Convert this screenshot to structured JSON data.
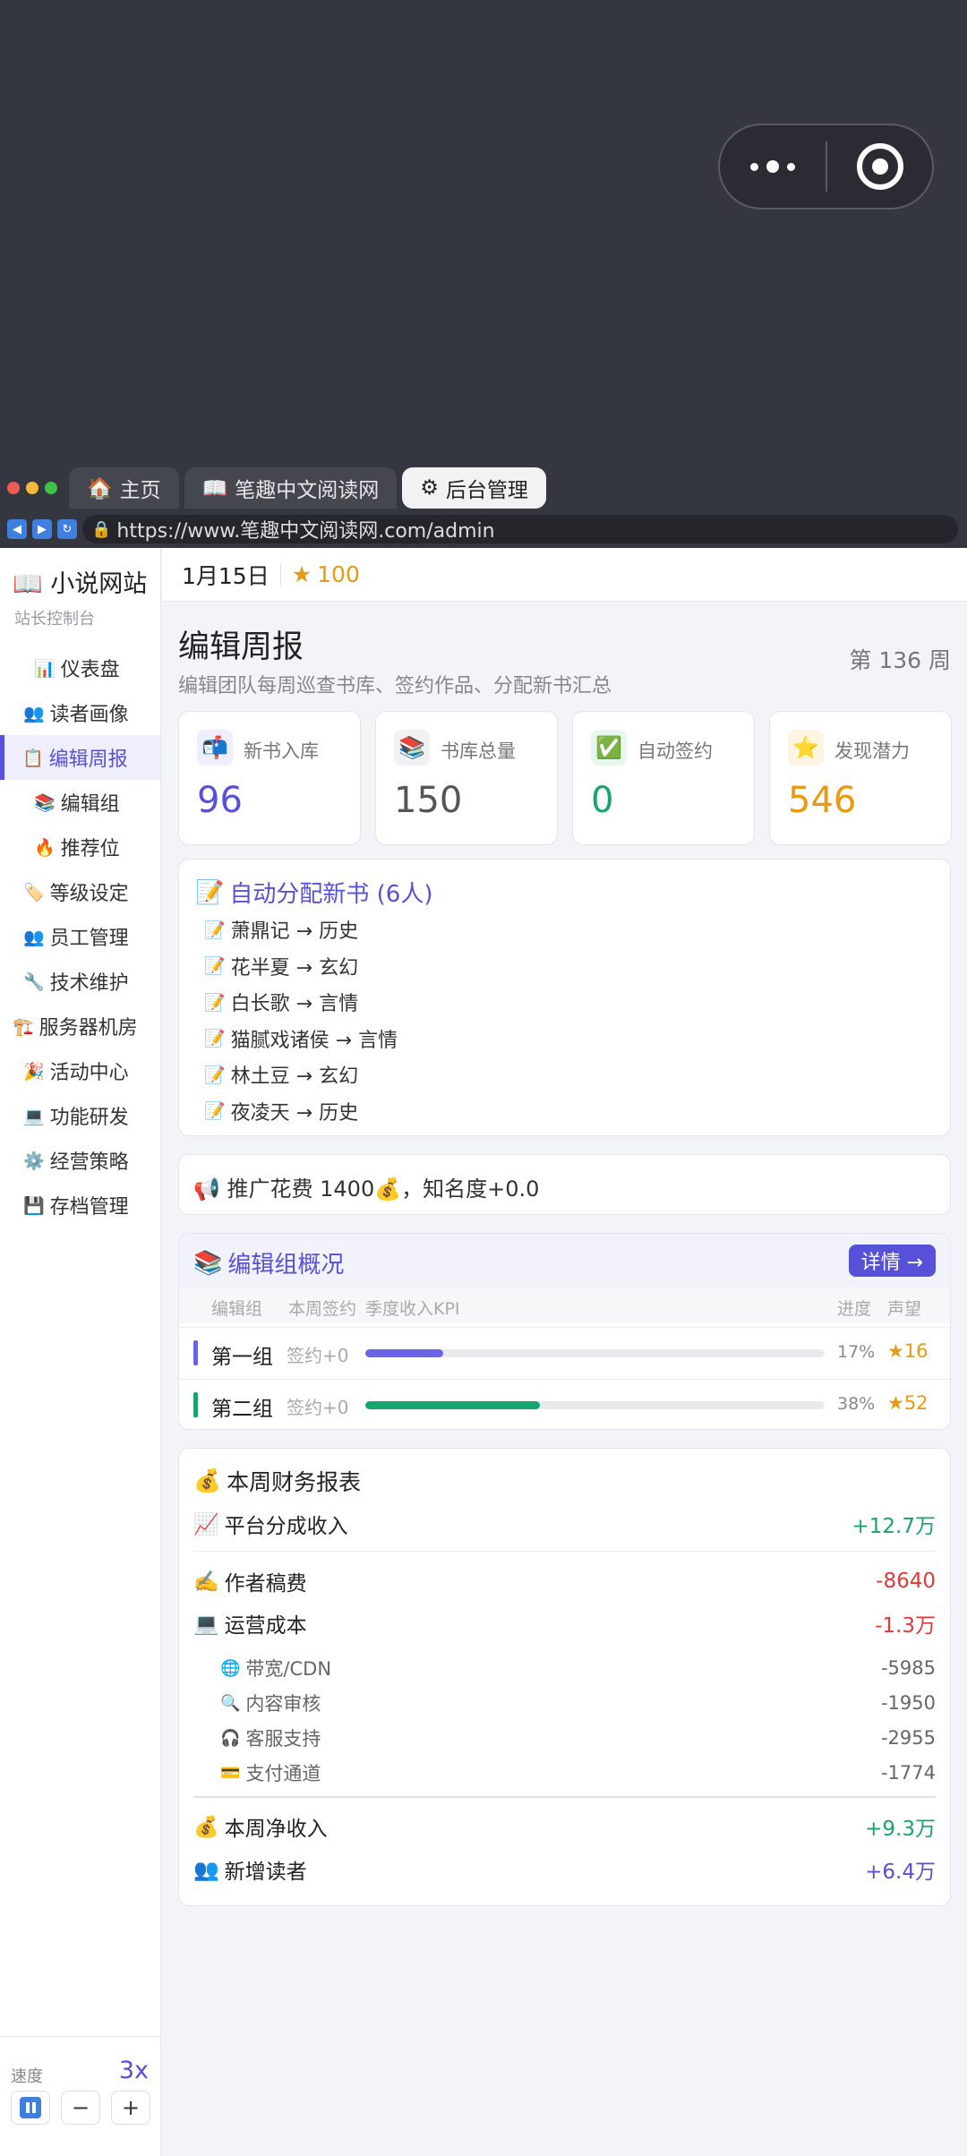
{
  "browser": {
    "tabs": [
      {
        "icon": "🏠",
        "label": "主页"
      },
      {
        "icon": "📖",
        "label": "笔趣中文阅读网"
      },
      {
        "icon": "⚙",
        "label": "后台管理"
      }
    ],
    "url": "https://www.笔趣中文阅读网.com/admin"
  },
  "sidebar": {
    "brand": "📖 小说网站",
    "brand_sub": "站长控制台",
    "items": [
      {
        "icon": "📊",
        "label": "仪表盘"
      },
      {
        "icon": "👥",
        "label": "读者画像"
      },
      {
        "icon": "📋",
        "label": "编辑周报"
      },
      {
        "icon": "📚",
        "label": "编辑组"
      },
      {
        "icon": "🔥",
        "label": "推荐位"
      },
      {
        "icon": "🏷️",
        "label": "等级设定"
      },
      {
        "icon": "👥",
        "label": "员工管理"
      },
      {
        "icon": "🔧",
        "label": "技术维护"
      },
      {
        "icon": "🏗️",
        "label": "服务器机房"
      },
      {
        "icon": "🎉",
        "label": "活动中心"
      },
      {
        "icon": "💻",
        "label": "功能研发"
      },
      {
        "icon": "⚙️",
        "label": "经营策略"
      },
      {
        "icon": "💾",
        "label": "存档管理"
      }
    ],
    "speed_label": "速度",
    "speed_value": "3x",
    "minus": "−",
    "plus": "+"
  },
  "header": {
    "date": "1月15日",
    "fame_icon": "★",
    "fame": "100"
  },
  "main": {
    "title": "编辑周报",
    "subtitle": "编辑团队每周巡查书库、签约作品、分配新书汇总",
    "week": "第 136 周",
    "stats": [
      {
        "icon": "📬",
        "label": "新书入库",
        "value": "96",
        "color": "#5750d8",
        "bg": "#eeeefc"
      },
      {
        "icon": "📚",
        "label": "书库总量",
        "value": "150",
        "color": "#555555",
        "bg": "#f1f1f4"
      },
      {
        "icon": "✅",
        "label": "自动签约",
        "value": "0",
        "color": "#16a56c",
        "bg": "#e6f7ee"
      },
      {
        "icon": "⭐",
        "label": "发现潜力",
        "value": "546",
        "color": "#e79a12",
        "bg": "#fdf4e2"
      }
    ],
    "assign": {
      "icon": "📝",
      "title": "自动分配新书 (6人)",
      "rows": [
        {
          "icon": "📝",
          "text": "萧鼎记 → 历史"
        },
        {
          "icon": "📝",
          "text": "花半夏 → 玄幻"
        },
        {
          "icon": "📝",
          "text": "白长歌 → 言情"
        },
        {
          "icon": "📝",
          "text": "猫腻戏诸侯 → 言情"
        },
        {
          "icon": "📝",
          "text": "林土豆 → 玄幻"
        },
        {
          "icon": "📝",
          "text": "夜凌天 → 历史"
        }
      ]
    },
    "promo": "📢 推广花费 1400💰，知名度+0.0",
    "groups": {
      "icon": "📚",
      "title": "编辑组概况",
      "detail": "详情 →",
      "columns": [
        "编辑组",
        "本周签约",
        "季度收入KPI",
        "进度",
        "声望"
      ],
      "rows": [
        {
          "name": "第一组",
          "signed": "签约+0",
          "progress": 0.17,
          "pct": "17%",
          "fame": "★16",
          "color": "#6a63e6"
        },
        {
          "name": "第二组",
          "signed": "签约+0",
          "progress": 0.38,
          "pct": "38%",
          "fame": "★52",
          "color": "#16a56c"
        }
      ]
    },
    "finance": {
      "icon": "💰",
      "title": "本周财务报表",
      "income": {
        "icon": "📈",
        "label": "平台分成收入",
        "value": "+12.7万"
      },
      "author": {
        "icon": "✍️",
        "label": "作者稿费",
        "value": "-8640"
      },
      "ops": {
        "icon": "💻",
        "label": "运营成本",
        "value": "-1.3万"
      },
      "ops_items": [
        {
          "icon": "🌐",
          "label": "带宽/CDN",
          "value": "-5985"
        },
        {
          "icon": "🔍",
          "label": "内容审核",
          "value": "-1950"
        },
        {
          "icon": "🎧",
          "label": "客服支持",
          "value": "-2955"
        },
        {
          "icon": "💳",
          "label": "支付通道",
          "value": "-1774"
        }
      ],
      "net": {
        "icon": "💰",
        "label": "本周净收入",
        "value": "+9.3万"
      },
      "readers": {
        "icon": "👥",
        "label": "新增读者",
        "value": "+6.4万"
      }
    }
  }
}
